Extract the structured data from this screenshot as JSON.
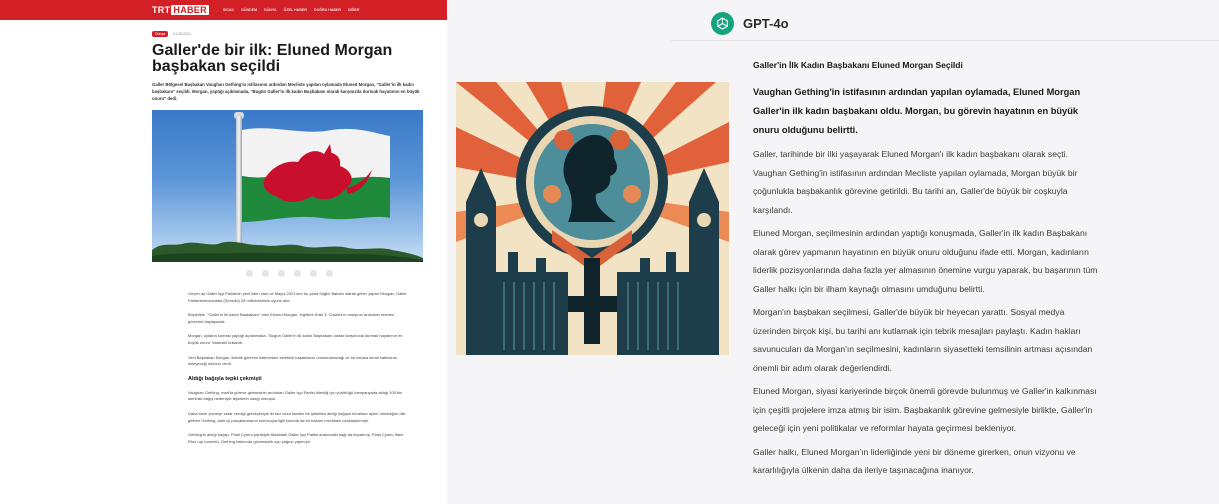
{
  "news": {
    "logo_trt": "TRT",
    "logo_haber": "HABER",
    "nav": [
      "SİCAK",
      "GÜNDEM",
      "DÜNYA",
      "ÖZEL HABER",
      "DOĞRU HABER",
      "DİĞER"
    ],
    "category": "Dünya",
    "date": "01.08.2024",
    "title": "Galler'de bir ilk: Eluned Morgan başbakan seçildi",
    "lead": "Galler Bölgesel Başbakan Vaughan Gething'in istifasının ardından Mecliste yapılan oylamada Eluned Morgan, \"Galler'in ilk kadın başbakanı\" seçildi. Morgan, yaptığı açıklamada, \"Bugün Galler'in ilk kadın Başbakanı olarak karşınızda durmak hayatımın en büyük onuru\" dedi.",
    "paragraphs": [
      "Geçen ay Galler İşçi Partisinin yeni lideri olan ve Mayıs 2021'den bu yana Sağlık Bakanı olarak görev yapan Morgan, Galler Parlamentosundaki (Senedd) 28 milletvekilinin oyunu aldı.",
      "Böylelikle, \"Galler'in ilk kadın Başbakanı\" olan Eluned Morgan, İngiltere Kralı 3. Charles'ın onayının ardından resmen görevine başlayacak.",
      "Morgan, oylama sonrası yaptığı açıklamada, \"Bugün Galler'in ilk kadın Başbakanı olarak karşınızda durmak hayatımın en büyük onuru\" ifadesini kullandı.",
      "Yeni Başbakan Morgan, liderlik görevini üstlenirken selefinin başarılarını onurlandıracağı ve bu mirasa kendi katkılarını ekleyeceği sözünü verdi."
    ],
    "subheading": "Aldığı bağışla tepki çekmişti",
    "paragraphs2": [
      "Vaughan Gething, mart'ta göreve gelmesinin ardından Galler İşçi Partisi liderliği için yürüttüğü kampanyada aldığı 200 bin sterlinlik bağış nedeniyle tepkilerin odağı olmuştu.",
      "Daha önce çevreye zarar verdiği gerekçesiyle iki kez ceza kesilen bir şirketten aldığı bağışın kurallara aykırı olmadığını dile getiren Gething, parti içi parçalanmanın sonucuyla ilgili konuda da bir bakanı meclisten uzaklaştırmıştı.",
      "Gething'in aldığı bağışı, Plaid Cymru partisiyle Aldatılabi Galler İşçi Partisi arasındaki bağı da koparmış, Plaid Cymru lideri Rhun ap Iorwerth, Gething hakkında güvensizlik oyu çağrısı yapmıştı."
    ]
  },
  "gpt": {
    "model_name": "GPT-4o",
    "accent_color": "#17a37f",
    "icon": "openai-logo-icon",
    "article": {
      "title": "Galler'in İlk Kadın Başbakanı Eluned Morgan Seçildi",
      "lead": "Vaughan Gething'in istifasının ardından yapılan oylamada, Eluned Morgan Galler'in ilk kadın başbakanı oldu. Morgan, bu görevin hayatının en büyük onuru olduğunu belirtti.",
      "paragraphs": [
        "Galler, tarihinde bir ilki yaşayarak Eluned Morgan'ı ilk kadın başbakanı olarak seçti. Vaughan Gething'in istifasının ardından Mecliste yapılan oylamada, Morgan büyük bir çoğunlukla başbakanlık görevine getirildi. Bu tarihi an, Galler'de büyük bir coşkuyla karşılandı.",
        "Eluned Morgan, seçilmesinin ardından yaptığı konuşmada, Galler'in ilk kadın Başbakanı olarak görev yapmanın hayatının en büyük onuru olduğunu ifade etti. Morgan, kadınların liderlik pozisyonlarında daha fazla yer almasının önemine vurgu yaparak, bu başarının tüm Galler halkı için bir ilham kaynağı olmasını umduğunu belirtti.",
        "Morgan'ın başbakan seçilmesi, Galler'de büyük bir heyecan yarattı. Sosyal medya üzerinden birçok kişi, bu tarihi anı kutlamak için tebrik mesajları paylaştı. Kadın hakları savunucuları da Morgan'ın seçilmesini, kadınların siyasetteki temsilinin artması açısından önemli bir adım olarak değerlendirdi.",
        "Eluned Morgan, siyasi kariyerinde birçok önemli görevde bulunmuş ve Galler'in kalkınması için çeşitli projelere imza atmış bir isim. Başbakanlık görevine gelmesiyle birlikte, Galler'in geleceği için yeni politikalar ve reformlar hayata geçirmesi bekleniyor.",
        "Galler halkı, Eluned Morgan'ın liderliğinde yeni bir döneme girerken, onun vizyonu ve kararlılığıyla ülkenin daha da ileriye taşınacağına inanıyor."
      ]
    }
  }
}
